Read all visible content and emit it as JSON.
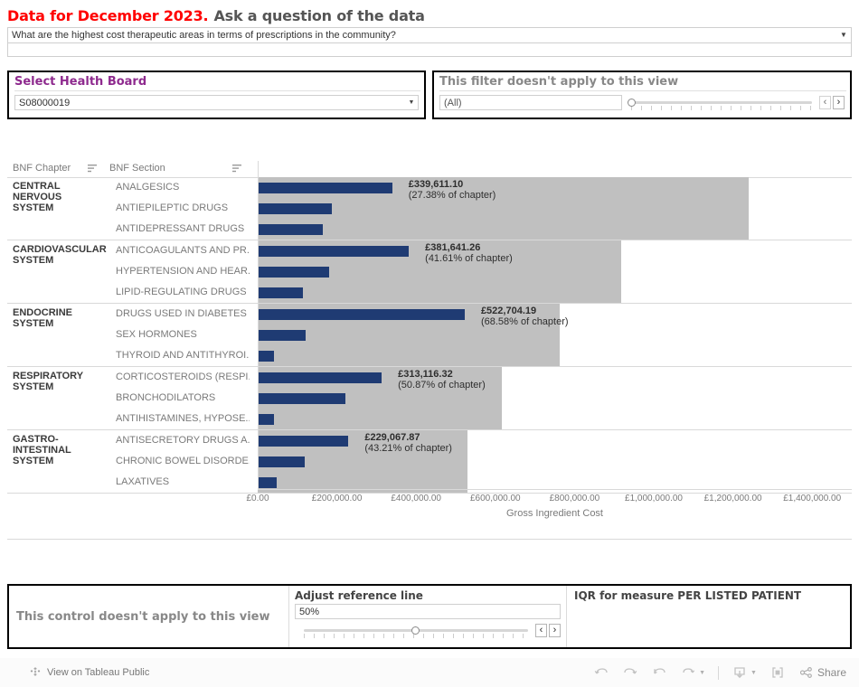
{
  "title": {
    "highlight": "Data for December 2023.",
    "rest": "Ask a question of the data"
  },
  "question": {
    "value": "What are the highest cost therapeutic areas in terms of prescriptions in the community?",
    "dropdown_icon": "chevron-down-icon"
  },
  "filters": {
    "health_board": {
      "caption": "Select Health Board",
      "value": "S08000019",
      "dropdown_icon": "chevron-down-icon"
    },
    "not_applicable": {
      "caption": "This filter doesn't apply to this view",
      "value": "(All)",
      "slider_position_pct": 0,
      "prev_label": "‹",
      "next_label": "›"
    }
  },
  "table": {
    "headers": {
      "chapter": "BNF Chapter",
      "section": "BNF Section",
      "sort_icon": "sort-descending-icon"
    }
  },
  "chart_data": {
    "type": "bar",
    "title": "",
    "xlabel": "Gross Ingredient Cost",
    "ylabel": "",
    "xlim": [
      0,
      1500000
    ],
    "xticks": [
      0,
      200000,
      400000,
      600000,
      800000,
      1000000,
      1200000,
      1400000
    ],
    "xtick_labels": [
      "£0.00",
      "£200,000.00",
      "£400,000.00",
      "£600,000.00",
      "£800,000.00",
      "£1,000,000.00",
      "£1,200,000.00",
      "£1,400,000.00"
    ],
    "grid": false,
    "legend": null,
    "bar_color": "#1f3b73",
    "reference_band_color": "#c0c0c0",
    "groups": [
      {
        "chapter": "CENTRAL NERVOUS SYSTEM",
        "chapter_total": 1240700,
        "sections": [
          {
            "section": "ANALGESICS",
            "value": 339611.1,
            "value_label": "£339,611.10",
            "pct_label": "(27.38% of chapter)",
            "pct_of_chapter": 27.38
          },
          {
            "section": "ANTIEPILEPTIC DRUGS",
            "value": 188000,
            "value_label": "",
            "pct_label": "",
            "pct_of_chapter": null
          },
          {
            "section": "ANTIDEPRESSANT DRUGS",
            "value": 165000,
            "value_label": "",
            "pct_label": "",
            "pct_of_chapter": null
          }
        ]
      },
      {
        "chapter": "CARDIOVASCULAR SYSTEM",
        "chapter_total": 917200,
        "sections": [
          {
            "section": "ANTICOAGULANTS AND PR..",
            "value": 381641.26,
            "value_label": "£381,641.26",
            "pct_label": "(41.61% of chapter)",
            "pct_of_chapter": 41.61
          },
          {
            "section": "HYPERTENSION AND HEAR..",
            "value": 180000,
            "value_label": "",
            "pct_label": "",
            "pct_of_chapter": null
          },
          {
            "section": "LIPID-REGULATING DRUGS",
            "value": 115000,
            "value_label": "",
            "pct_label": "",
            "pct_of_chapter": null
          }
        ]
      },
      {
        "chapter": "ENDOCRINE SYSTEM",
        "chapter_total": 762200,
        "sections": [
          {
            "section": "DRUGS USED IN DIABETES",
            "value": 522704.19,
            "value_label": "£522,704.19",
            "pct_label": "(68.58% of chapter)",
            "pct_of_chapter": 68.58
          },
          {
            "section": "SEX HORMONES",
            "value": 122000,
            "value_label": "",
            "pct_label": "",
            "pct_of_chapter": null
          },
          {
            "section": "THYROID AND ANTITHYROI..",
            "value": 40000,
            "value_label": "",
            "pct_label": "",
            "pct_of_chapter": null
          }
        ]
      },
      {
        "chapter": "RESPIRATORY SYSTEM",
        "chapter_total": 615500,
        "sections": [
          {
            "section": "CORTICOSTEROIDS (RESPI..",
            "value": 313116.32,
            "value_label": "£313,116.32",
            "pct_label": "(50.87% of chapter)",
            "pct_of_chapter": 50.87
          },
          {
            "section": "BRONCHODILATORS",
            "value": 222000,
            "value_label": "",
            "pct_label": "",
            "pct_of_chapter": null
          },
          {
            "section": "ANTIHISTAMINES, HYPOSE..",
            "value": 42000,
            "value_label": "",
            "pct_label": "",
            "pct_of_chapter": null
          }
        ]
      },
      {
        "chapter": "GASTRO-INTESTINAL SYSTEM",
        "chapter_total": 530100,
        "sections": [
          {
            "section": "ANTISECRETORY DRUGS A..",
            "value": 229067.87,
            "value_label": "£229,067.87",
            "pct_label": "(43.21% of chapter)",
            "pct_of_chapter": 43.21
          },
          {
            "section": "CHRONIC BOWEL DISORDE..",
            "value": 119000,
            "value_label": "",
            "pct_label": "",
            "pct_of_chapter": null
          },
          {
            "section": "LAXATIVES",
            "value": 48000,
            "value_label": "",
            "pct_label": "",
            "pct_of_chapter": null
          }
        ]
      }
    ]
  },
  "bottom_controls": {
    "not_applicable_text": "This control doesn't apply to this view",
    "reference_line": {
      "caption": "Adjust reference line",
      "value": "50%",
      "slider_position_pct": 50,
      "prev_label": "‹",
      "next_label": "›"
    },
    "iqr": {
      "caption": "IQR for measure PER LISTED PATIENT"
    }
  },
  "footer": {
    "tableau_link": "View on Tableau Public",
    "tableau_icon": "tableau-logo-icon",
    "tools": [
      {
        "name": "undo-icon",
        "label": ""
      },
      {
        "name": "redo-icon",
        "label": ""
      },
      {
        "name": "revert-icon",
        "label": ""
      },
      {
        "name": "refresh-icon",
        "label": ""
      },
      {
        "name": "download-icon",
        "label": ""
      },
      {
        "name": "fullscreen-icon",
        "label": ""
      }
    ],
    "share_label": "Share",
    "share_icon": "share-icon"
  }
}
